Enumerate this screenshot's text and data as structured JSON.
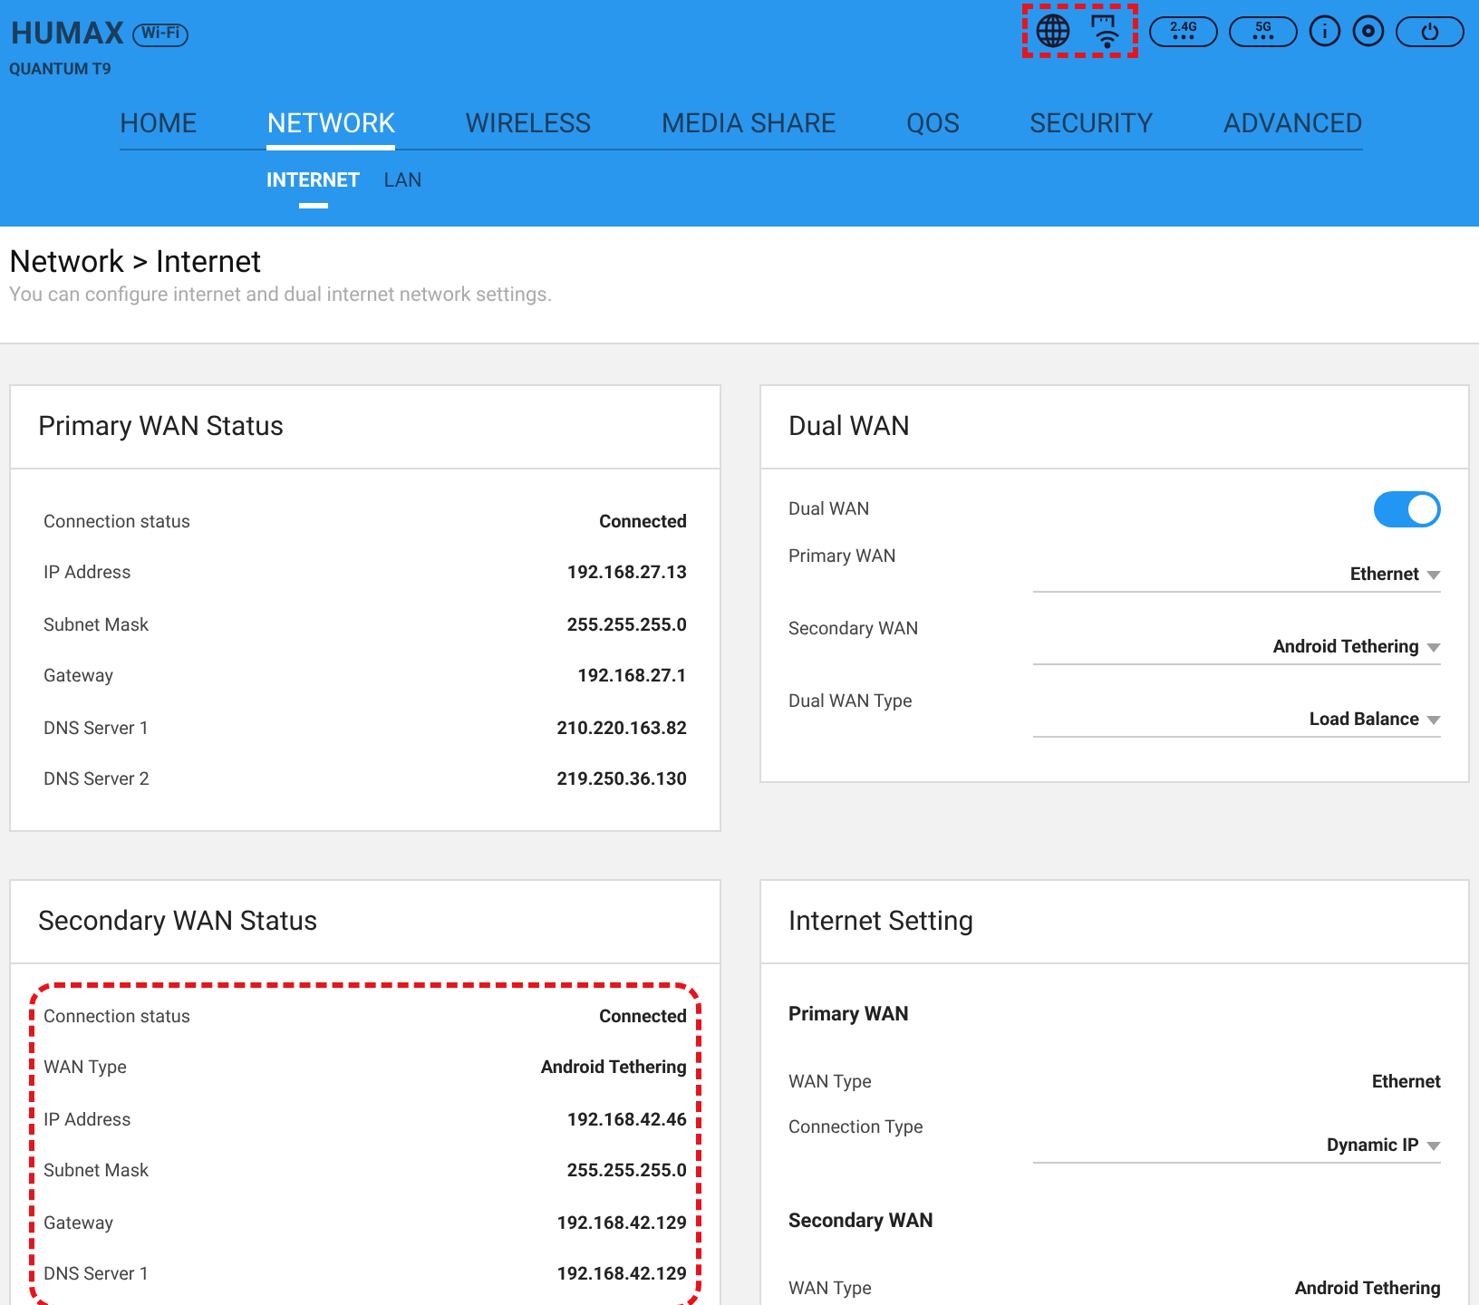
{
  "header": {
    "logo": "HUMAX",
    "logo_badge": "Wi-Fi",
    "model": "QUANTUM T9",
    "status_icons_highlighted": true,
    "band_buttons": [
      "2.4G",
      "5G"
    ]
  },
  "nav": {
    "tabs": [
      {
        "label": "HOME",
        "selected": false
      },
      {
        "label": "NETWORK",
        "selected": true
      },
      {
        "label": "WIRELESS",
        "selected": false
      },
      {
        "label": "MEDIA SHARE",
        "selected": false
      },
      {
        "label": "QOS",
        "selected": false
      },
      {
        "label": "SECURITY",
        "selected": false
      },
      {
        "label": "ADVANCED",
        "selected": false
      }
    ],
    "subtabs": [
      {
        "label": "INTERNET",
        "selected": true
      },
      {
        "label": "LAN",
        "selected": false
      }
    ]
  },
  "page": {
    "title": "Network > Internet",
    "subtitle": "You can configure internet and dual internet network settings."
  },
  "primary_wan_status": {
    "title": "Primary WAN Status",
    "highlighted": false,
    "rows": [
      {
        "label": "Connection status",
        "value": "Connected"
      },
      {
        "label": "IP Address",
        "value": "192.168.27.13"
      },
      {
        "label": "Subnet Mask",
        "value": "255.255.255.0"
      },
      {
        "label": "Gateway",
        "value": "192.168.27.1"
      },
      {
        "label": "DNS Server 1",
        "value": "210.220.163.82"
      },
      {
        "label": "DNS Server 2",
        "value": "219.250.36.130"
      }
    ]
  },
  "dual_wan": {
    "title": "Dual WAN",
    "rows": [
      {
        "kind": "toggle",
        "label": "Dual WAN",
        "on": true
      },
      {
        "kind": "select",
        "label": "Primary WAN",
        "value": "Ethernet"
      },
      {
        "kind": "select",
        "label": "Secondary WAN",
        "value": "Android Tethering"
      },
      {
        "kind": "select",
        "label": "Dual WAN Type",
        "value": "Load Balance"
      }
    ]
  },
  "secondary_wan_status": {
    "title": "Secondary WAN Status",
    "highlighted": true,
    "rows": [
      {
        "label": "Connection status",
        "value": "Connected"
      },
      {
        "label": "WAN Type",
        "value": "Android Tethering"
      },
      {
        "label": "IP Address",
        "value": "192.168.42.46"
      },
      {
        "label": "Subnet Mask",
        "value": "255.255.255.0"
      },
      {
        "label": "Gateway",
        "value": "192.168.42.129"
      },
      {
        "label": "DNS Server 1",
        "value": "192.168.42.129"
      }
    ]
  },
  "internet_setting": {
    "title": "Internet Setting",
    "rows": [
      {
        "kind": "heading",
        "label": "Primary WAN"
      },
      {
        "kind": "text",
        "label": "WAN Type",
        "value": "Ethernet"
      },
      {
        "kind": "select",
        "label": "Connection Type",
        "value": "Dynamic IP"
      },
      {
        "kind": "heading",
        "label": "Secondary WAN"
      },
      {
        "kind": "text",
        "label": "WAN Type",
        "value": "Android Tethering"
      }
    ]
  }
}
